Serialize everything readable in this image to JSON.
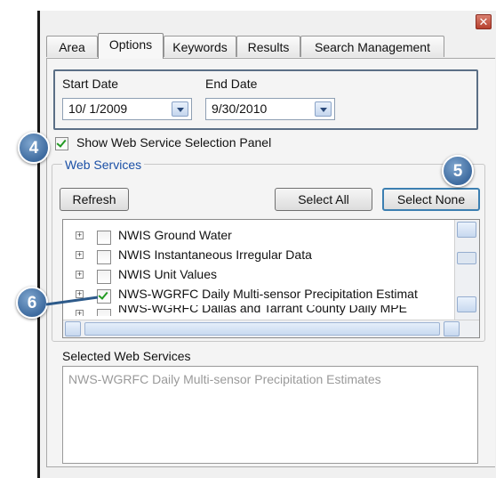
{
  "window": {
    "close_glyph": "✕"
  },
  "tabs": [
    {
      "label": "Area"
    },
    {
      "label": "Options"
    },
    {
      "label": "Keywords"
    },
    {
      "label": "Results"
    },
    {
      "label": "Search Management"
    }
  ],
  "dates": {
    "start_label": "Start Date",
    "start_value": "10/  1/2009",
    "end_label": "End Date",
    "end_value": "9/30/2010"
  },
  "show_panel": {
    "label": "Show Web Service Selection Panel",
    "checked": true
  },
  "web_services": {
    "title": "Web Services",
    "refresh": "Refresh",
    "select_all": "Select All",
    "select_none": "Select None",
    "items": [
      {
        "label": "NWIS Ground Water",
        "checked": false
      },
      {
        "label": "NWIS Instantaneous Irregular Data",
        "checked": false
      },
      {
        "label": "NWIS Unit Values",
        "checked": false
      },
      {
        "label": "NWS-WGRFC Daily Multi-sensor Precipitation Estimat",
        "checked": true
      },
      {
        "label": "NWS-WGRFC Dallas and Tarrant County Daily MPE",
        "checked": false
      }
    ]
  },
  "selected": {
    "label": "Selected Web Services",
    "items": [
      "NWS-WGRFC Daily Multi-sensor Precipitation Estimates"
    ]
  },
  "callouts": [
    "4",
    "5",
    "6"
  ],
  "colors": {
    "accent": "#1b50a6",
    "callout": "#4a76a8",
    "checkmark": "#239a23"
  }
}
